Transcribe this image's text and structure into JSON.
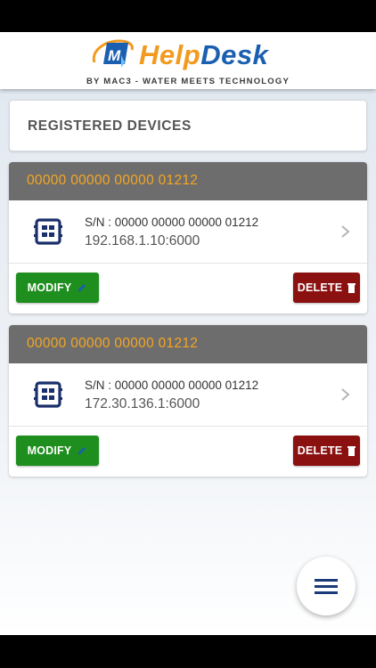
{
  "app": {
    "logo_help": "Help",
    "logo_desk": "Desk",
    "tagline": "BY MAC3 - WATER MEETS TECHNOLOGY"
  },
  "page": {
    "title": "REGISTERED DEVICES"
  },
  "devices": [
    {
      "header": "00000 00000 00000 01212",
      "serial": "S/N : 00000 00000 00000 01212",
      "address": "192.168.1.10:6000",
      "modify_label": "MODIFY",
      "delete_label": "DELETE"
    },
    {
      "header": "00000 00000 00000 01212",
      "serial": "S/N : 00000 00000 00000 01212",
      "address": "172.30.136.1:6000",
      "modify_label": "MODIFY",
      "delete_label": "DELETE"
    }
  ],
  "icons": {
    "device": "device-icon",
    "chevron": "chevron-right-icon",
    "edit": "pencil-icon",
    "delete": "trash-icon",
    "menu": "hamburger-menu-icon"
  },
  "colors": {
    "header_text": "#f5a623",
    "card_header_bg": "#6d6d6d",
    "modify_bg": "#1e8e1e",
    "delete_bg": "#8b1010",
    "accent_blue": "#1b5fb0"
  }
}
